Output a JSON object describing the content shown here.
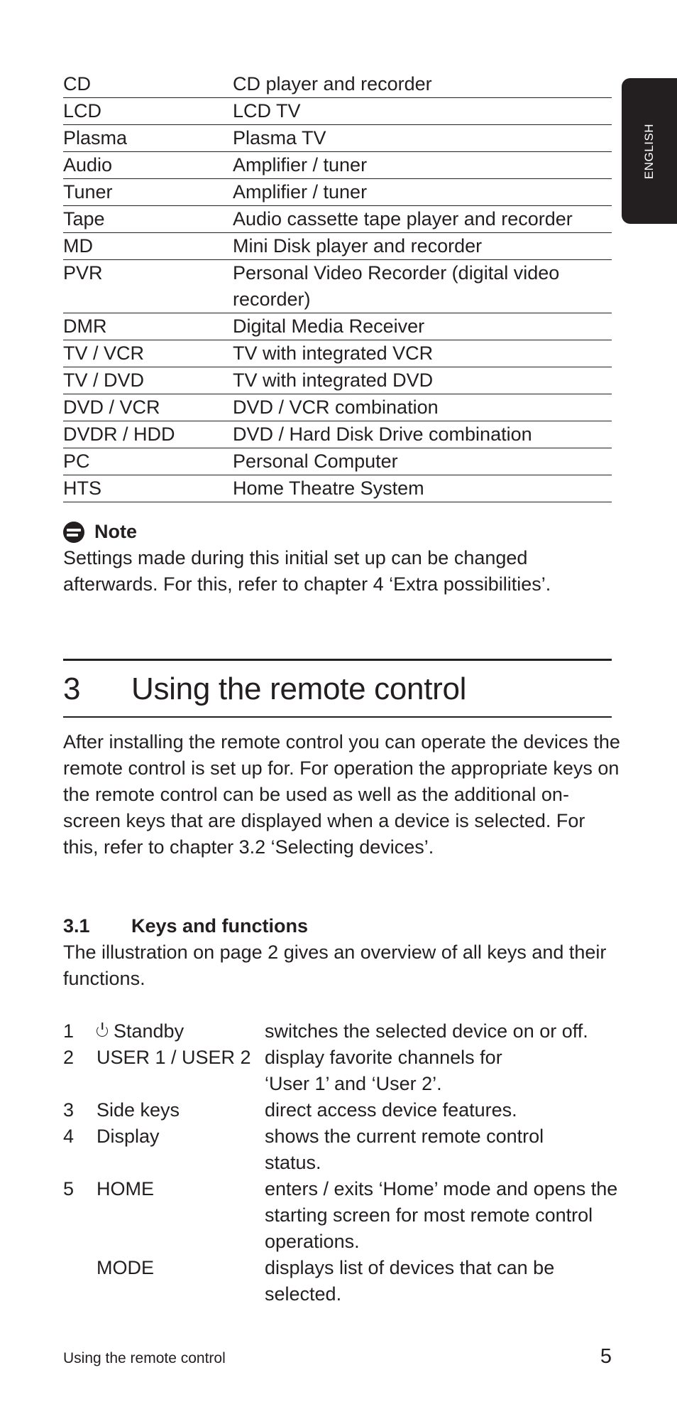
{
  "side_tab": {
    "label": "ENGLISH"
  },
  "device_table": {
    "rows": [
      {
        "abbr": "CD",
        "desc": "CD player and recorder"
      },
      {
        "abbr": "LCD",
        "desc": "LCD TV"
      },
      {
        "abbr": "Plasma",
        "desc": "Plasma TV"
      },
      {
        "abbr": "Audio",
        "desc": "Amplifier / tuner"
      },
      {
        "abbr": "Tuner",
        "desc": "Amplifier / tuner"
      },
      {
        "abbr": "Tape",
        "desc": "Audio cassette tape player and recorder"
      },
      {
        "abbr": "MD",
        "desc": "Mini Disk player and recorder"
      },
      {
        "abbr": "PVR",
        "desc": "Personal Video Recorder (digital video recorder)"
      },
      {
        "abbr": "DMR",
        "desc": "Digital Media Receiver"
      },
      {
        "abbr": "TV / VCR",
        "desc": "TV with integrated VCR"
      },
      {
        "abbr": "TV / DVD",
        "desc": "TV with integrated DVD"
      },
      {
        "abbr": "DVD / VCR",
        "desc": "DVD / VCR combination"
      },
      {
        "abbr": "DVDR / HDD",
        "desc": "DVD / Hard Disk Drive combination"
      },
      {
        "abbr": "PC",
        "desc": "Personal Computer"
      },
      {
        "abbr": "HTS",
        "desc": "Home Theatre System"
      }
    ]
  },
  "note": {
    "icon": "note-icon",
    "title": "Note",
    "text": "Settings made during this initial set up can be changed afterwards. For this, refer to chapter 4 ‘Extra possibilities’."
  },
  "chapter": {
    "number": "3",
    "title": "Using the remote control",
    "intro": "After installing the remote control you can operate the devices the remote control is set up for. For operation the appropriate keys on the remote control can be used as well as the additional on-screen keys that are displayed when a device is selected. For this, refer to chapter 3.2 ‘Selecting devices’."
  },
  "section": {
    "number": "3.1",
    "title": "Keys and functions",
    "text": "The illustration on page 2 gives an overview of all keys and their functions."
  },
  "keys": [
    {
      "num": "1",
      "icon": "power-icon",
      "name": "Standby",
      "desc": "switches the selected device on or off."
    },
    {
      "num": "2",
      "name": "USER 1 / USER 2",
      "desc": "display favorite channels for ‘User 1’ and ‘User 2’."
    },
    {
      "num": "3",
      "name": "Side keys",
      "desc": "direct access device features."
    },
    {
      "num": "4",
      "name": "Display",
      "desc": "shows the current remote control status."
    },
    {
      "num": "5",
      "name": "HOME",
      "desc": "enters / exits ‘Home’ mode and opens the starting screen for most remote control operations."
    },
    {
      "num": "",
      "name": "MODE",
      "desc": "displays list of devices that can be selected."
    }
  ],
  "footer": {
    "section_label": "Using the remote control",
    "page_number": "5"
  }
}
